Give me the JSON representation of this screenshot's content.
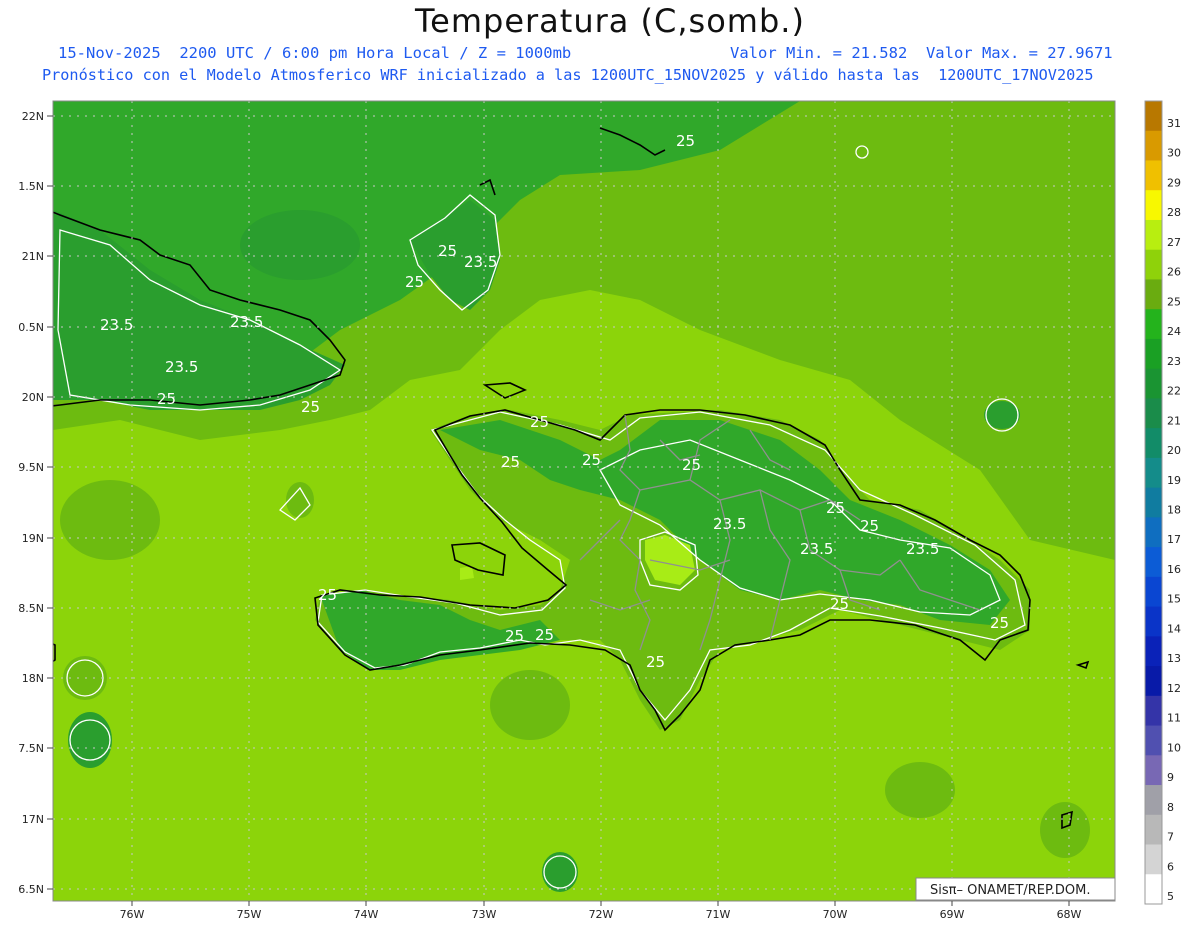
{
  "title": "Temperatura (C,somb.)",
  "subtitle_left": "15-Nov-2025  2200 UTC / 6:00 pm Hora Local / Z = 1000mb",
  "subtitle_right": "Valor Min. = 21.582  Valor Max. = 27.9671",
  "subtitle_2": "Pronóstico con el Modelo Atmosferico WRF inicializado a las 1200UTC_15NOV2025 y válido hasta las  1200UTC_17NOV2025",
  "credit": "Sisπ– ONAMET/REP.DOM.",
  "lat_ticks": [
    "22N",
    "1.5N",
    "21N",
    "0.5N",
    "20N",
    "9.5N",
    "19N",
    "8.5N",
    "18N",
    "7.5N",
    "17N",
    "6.5N"
  ],
  "lon_ticks": [
    "76W",
    "75W",
    "74W",
    "73W",
    "72W",
    "71W",
    "70W",
    "69W",
    "68W"
  ],
  "legend": {
    "labels": [
      "31",
      "30",
      "29",
      "28",
      "27",
      "26",
      "25",
      "24",
      "23",
      "22",
      "21",
      "20",
      "19",
      "18",
      "17",
      "16",
      "15",
      "14",
      "13",
      "12",
      "11",
      "10",
      "9",
      "8",
      "7",
      "6",
      "5"
    ],
    "colors": [
      "#b87800",
      "#d99a00",
      "#f0c000",
      "#f8f800",
      "#b8ee10",
      "#8fd20a",
      "#6aac10",
      "#24b31c",
      "#1aa024",
      "#1a9432",
      "#1a8c4a",
      "#128c68",
      "#148c8a",
      "#107ca0",
      "#0f6ec0",
      "#0c5cd6",
      "#0a46d2",
      "#0a34c8",
      "#0a22b8",
      "#081aa8",
      "#3434a8",
      "#5050b0",
      "#7868b4",
      "#a0a0a8",
      "#b8b8b8",
      "#d4d4d4",
      "#ffffff"
    ]
  },
  "contour_labels": [
    "25",
    "23.5",
    "25",
    "23.5",
    "25",
    "23.5",
    "23.5",
    "23.5",
    "25",
    "25",
    "25",
    "25",
    "25",
    "25",
    "23.5",
    "25",
    "23.5",
    "25",
    "25",
    "25",
    "25",
    "25",
    "25",
    "25"
  ],
  "colors": {
    "bg_field": "#8cd40a",
    "mid_field": "#6dbb10",
    "dark_field": "#30a82a",
    "land_dark": "#2a9e2e",
    "hot": "#a8ec16"
  }
}
